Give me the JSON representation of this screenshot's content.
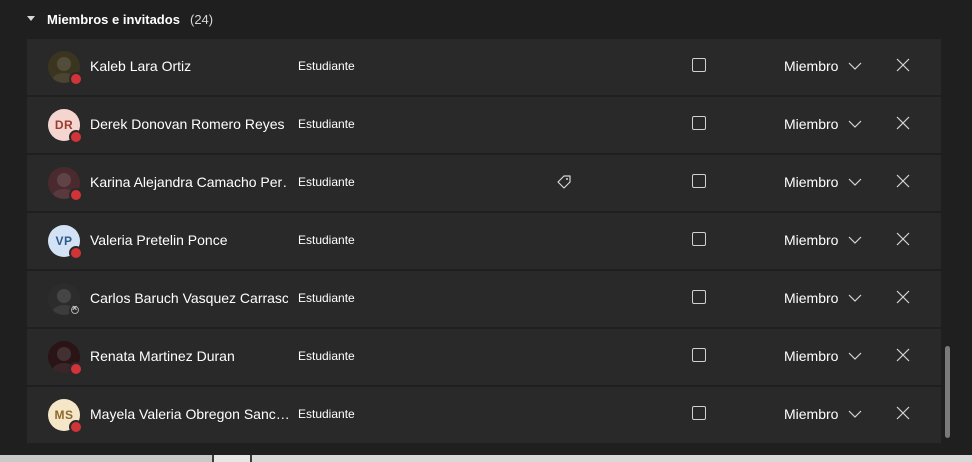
{
  "section": {
    "title": "Miembros e invitados",
    "count": "(24)"
  },
  "members": [
    {
      "name": "Kaleb Lara Ortiz",
      "role": "Estudiante",
      "role_dropdown": "Miembro",
      "avatar_initials": "",
      "avatar_type": "photo",
      "avatar_bg": "#3b3520",
      "presence": "busy",
      "has_tag_icon": false
    },
    {
      "name": "Derek Donovan Romero Reyes",
      "role": "Estudiante",
      "role_dropdown": "Miembro",
      "avatar_initials": "DR",
      "avatar_type": "initials",
      "avatar_bg": "#f5d5cf",
      "avatar_fg": "#9b3b2e",
      "presence": "busy",
      "has_tag_icon": false
    },
    {
      "name": "Karina Alejandra Camacho Per…",
      "role": "Estudiante",
      "role_dropdown": "Miembro",
      "avatar_initials": "",
      "avatar_type": "photo",
      "avatar_bg": "#4a2a2e",
      "presence": "busy",
      "has_tag_icon": true
    },
    {
      "name": "Valeria Pretelin Ponce",
      "role": "Estudiante",
      "role_dropdown": "Miembro",
      "avatar_initials": "VP",
      "avatar_type": "initials",
      "avatar_bg": "#d3e3f5",
      "avatar_fg": "#2e5a8a",
      "presence": "busy",
      "has_tag_icon": false
    },
    {
      "name": "Carlos Baruch Vasquez Carrasco",
      "role": "Estudiante",
      "role_dropdown": "Miembro",
      "avatar_initials": "",
      "avatar_type": "photo",
      "avatar_bg": "#2c2c2c",
      "presence": "offline",
      "has_tag_icon": false
    },
    {
      "name": "Renata Martinez Duran",
      "role": "Estudiante",
      "role_dropdown": "Miembro",
      "avatar_initials": "",
      "avatar_type": "photo",
      "avatar_bg": "#2a1416",
      "presence": "busy",
      "has_tag_icon": false
    },
    {
      "name": "Mayela Valeria Obregon Sanc…",
      "role": "Estudiante",
      "role_dropdown": "Miembro",
      "avatar_initials": "MS",
      "avatar_type": "initials",
      "avatar_bg": "#f5e6c8",
      "avatar_fg": "#8a6a2e",
      "presence": "busy",
      "has_tag_icon": false
    }
  ],
  "colors": {
    "background": "#1f1f1f",
    "row": "#292929",
    "busy": "#d13438"
  }
}
